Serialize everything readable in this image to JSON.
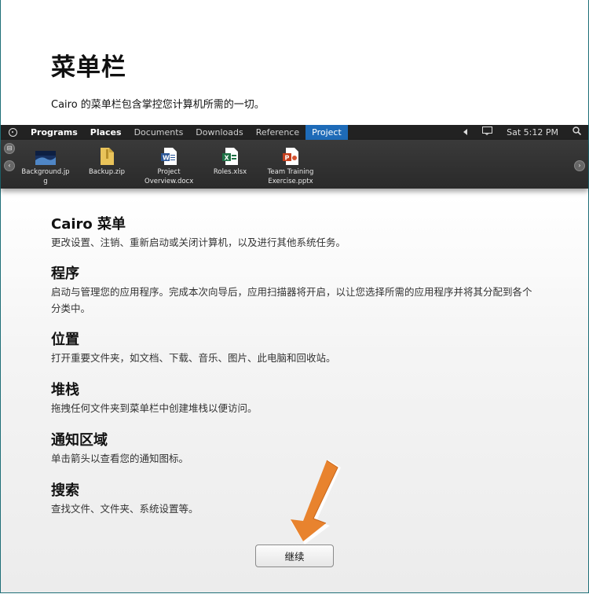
{
  "page": {
    "title": "菜单栏",
    "subtitle": "Cairo 的菜单栏包含掌控您计算机所需的一切。"
  },
  "menubar": {
    "items": [
      {
        "label": "Programs"
      },
      {
        "label": "Places"
      },
      {
        "label": "Documents"
      },
      {
        "label": "Downloads"
      },
      {
        "label": "Reference"
      },
      {
        "label": "Project"
      }
    ],
    "clock": "Sat 5:12 PM"
  },
  "stack": {
    "files": [
      {
        "name": "Background.jpg",
        "icon": "image-file-icon"
      },
      {
        "name": "Backup.zip",
        "icon": "zip-file-icon"
      },
      {
        "name": "Project Overview.docx",
        "icon": "word-file-icon"
      },
      {
        "name": "Roles.xlsx",
        "icon": "excel-file-icon"
      },
      {
        "name": "Team Training Exercise.pptx",
        "icon": "powerpoint-file-icon"
      }
    ]
  },
  "sections": [
    {
      "heading": "Cairo 菜单",
      "text": "更改设置、注销、重新启动或关闭计算机，以及进行其他系统任务。"
    },
    {
      "heading": "程序",
      "text": "启动与管理您的应用程序。完成本次向导后，应用扫描器将开启，以让您选择所需的应用程序并将其分配到各个分类中。"
    },
    {
      "heading": "位置",
      "text": "打开重要文件夹，如文档、下载、音乐、图片、此电脑和回收站。"
    },
    {
      "heading": "堆栈",
      "text": "拖拽任何文件夹到菜单栏中创建堆栈以便访问。"
    },
    {
      "heading": "通知区域",
      "text": "单击箭头以查看您的通知图标。"
    },
    {
      "heading": "搜索",
      "text": "查找文件、文件夹、系统设置等。"
    }
  ],
  "buttons": {
    "continue": "继续"
  },
  "colors": {
    "menubar_bg": "#222222",
    "active_tab": "#1e6bb8",
    "arrow": "#e8832e"
  }
}
